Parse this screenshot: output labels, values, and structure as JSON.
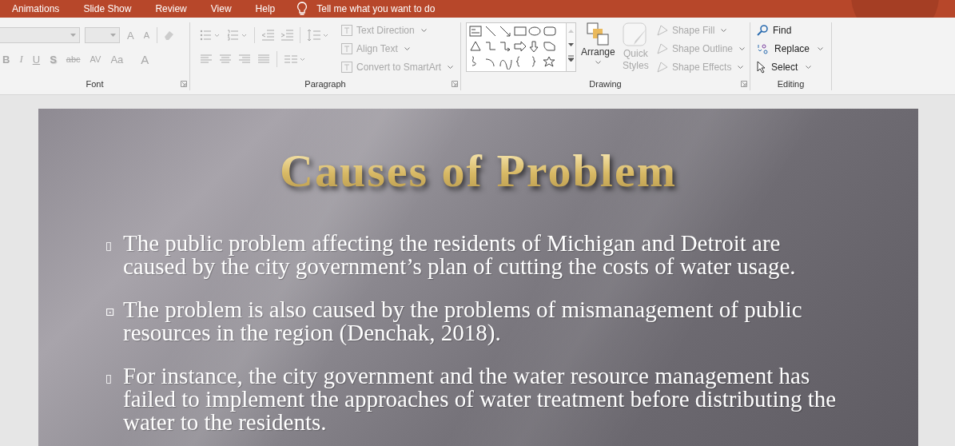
{
  "menu_tabs": [
    {
      "label": "Animations",
      "selected": false
    },
    {
      "label": "Slide Show",
      "selected": false
    },
    {
      "label": "Review",
      "selected": false
    },
    {
      "label": "View",
      "selected": false
    },
    {
      "label": "Help",
      "selected": false
    }
  ],
  "tell_me": {
    "placeholder": "Tell me what you want to do"
  },
  "ribbon": {
    "font": {
      "label": "Font",
      "grow_buttons": [
        "A",
        "A"
      ],
      "format_buttons": [
        "B",
        "I",
        "U",
        "S",
        "abc",
        "AV",
        "Aa",
        "A"
      ]
    },
    "paragraph": {
      "label": "Paragraph",
      "commands": [
        {
          "label": "Text Direction",
          "disabled": true
        },
        {
          "label": "Align Text",
          "disabled": true
        },
        {
          "label": "Convert to SmartArt",
          "disabled": true
        }
      ]
    },
    "drawing": {
      "label": "Drawing",
      "arrange": {
        "label": "Arrange",
        "disabled": false
      },
      "quick_styles": {
        "label": "Quick Styles",
        "disabled": true
      },
      "commands": [
        {
          "label": "Shape Fill",
          "disabled": true
        },
        {
          "label": "Shape Outline",
          "disabled": true
        },
        {
          "label": "Shape Effects",
          "disabled": true
        }
      ]
    },
    "editing": {
      "label": "Editing",
      "commands": [
        {
          "kind": "find",
          "label": "Find"
        },
        {
          "kind": "replace",
          "label": "Replace"
        },
        {
          "kind": "select",
          "label": "Select"
        }
      ]
    }
  },
  "slide": {
    "title": "Causes of Problem",
    "bullets": [
      {
        "marker": "▯",
        "text": "The public problem affecting the residents of Michigan and Detroit are caused by the city government’s plan of cutting the costs of water usage."
      },
      {
        "marker": "⊡",
        "text": "The problem is also caused by the problems of mismanagement of public resources in the region (Denchak, 2018)."
      },
      {
        "marker": "▯",
        "text": "For instance, the city government and the water resource management has failed to implement the approaches of water treatment before distributing the water to the residents."
      }
    ]
  }
}
